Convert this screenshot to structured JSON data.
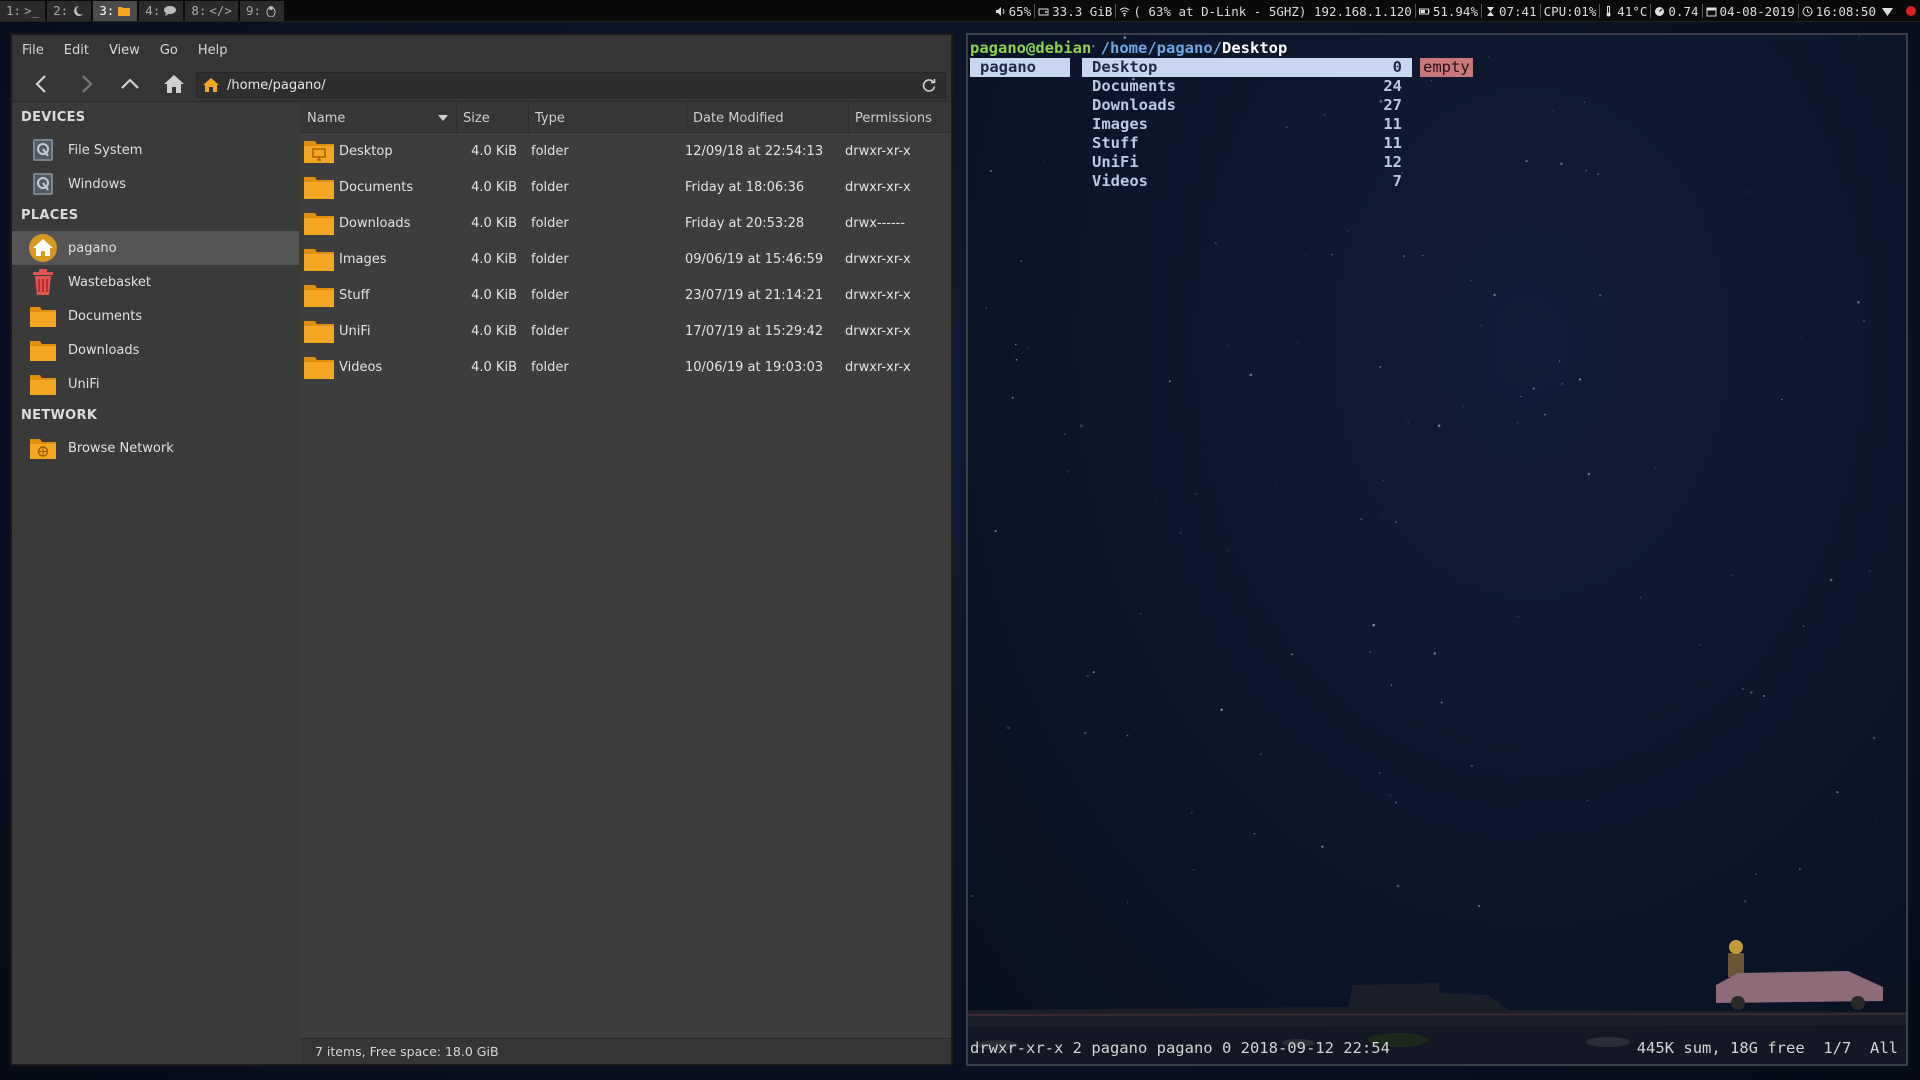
{
  "topbar": {
    "workspaces": [
      {
        "num": "1:",
        "icon": "terminal-icon",
        "glyph": ">_"
      },
      {
        "num": "2:",
        "icon": "moon-icon",
        "glyph": ""
      },
      {
        "num": "3:",
        "icon": "folder-icon",
        "glyph": "",
        "focused": true
      },
      {
        "num": "4:",
        "icon": "chat-icon",
        "glyph": ""
      },
      {
        "num": "8:",
        "icon": "code-icon",
        "glyph": "</>"
      },
      {
        "num": "9:",
        "icon": "linux-icon",
        "glyph": ""
      }
    ],
    "volume": "65%",
    "disk": "33.3 GiB",
    "wifi": "( 63% at D-Link - 5GHZ) 192.168.1.120",
    "battery": "51.94%",
    "battery_time": "07:41",
    "cpu": "CPU:01%",
    "temp": "41°C",
    "load": "0.74",
    "date": "04-08-2019",
    "time": "16:08:50"
  },
  "filemanager": {
    "menu": [
      "File",
      "Edit",
      "View",
      "Go",
      "Help"
    ],
    "location": "/home/pagano/",
    "sidebar": {
      "devices_heading": "DEVICES",
      "devices": [
        {
          "label": "File System",
          "icon": "drive-icon"
        },
        {
          "label": "Windows",
          "icon": "drive-icon"
        }
      ],
      "places_heading": "PLACES",
      "places": [
        {
          "label": "pagano",
          "icon": "home-icon",
          "selected": true
        },
        {
          "label": "Wastebasket",
          "icon": "trash-icon"
        },
        {
          "label": "Documents",
          "icon": "folder-icon"
        },
        {
          "label": "Downloads",
          "icon": "folder-icon"
        },
        {
          "label": "UniFi",
          "icon": "folder-icon"
        }
      ],
      "network_heading": "NETWORK",
      "network": [
        {
          "label": "Browse Network",
          "icon": "network-folder-icon"
        }
      ]
    },
    "columns": [
      "Name",
      "Size",
      "Type",
      "Date Modified",
      "Permissions"
    ],
    "rows": [
      {
        "name": "Desktop",
        "size": "4.0 KiB",
        "type": "folder",
        "date": "12/09/18 at 22:54:13",
        "perm": "drwxr-xr-x",
        "icon": "desktop-folder-icon"
      },
      {
        "name": "Documents",
        "size": "4.0 KiB",
        "type": "folder",
        "date": "Friday at 18:06:36",
        "perm": "drwxr-xr-x",
        "icon": "folder-icon"
      },
      {
        "name": "Downloads",
        "size": "4.0 KiB",
        "type": "folder",
        "date": "Friday at 20:53:28",
        "perm": "drwx------",
        "icon": "folder-icon"
      },
      {
        "name": "Images",
        "size": "4.0 KiB",
        "type": "folder",
        "date": "09/06/19 at 15:46:59",
        "perm": "drwxr-xr-x",
        "icon": "folder-icon"
      },
      {
        "name": "Stuff",
        "size": "4.0 KiB",
        "type": "folder",
        "date": "23/07/19 at 21:14:21",
        "perm": "drwxr-xr-x",
        "icon": "folder-icon"
      },
      {
        "name": "UniFi",
        "size": "4.0 KiB",
        "type": "folder",
        "date": "17/07/19 at 15:29:42",
        "perm": "drwxr-xr-x",
        "icon": "folder-icon"
      },
      {
        "name": "Videos",
        "size": "4.0 KiB",
        "type": "folder",
        "date": "10/06/19 at 19:03:03",
        "perm": "drwxr-xr-x",
        "icon": "folder-icon"
      }
    ],
    "status": "7 items, Free space: 18.0 GiB"
  },
  "terminal": {
    "prompt_user": "pagano@debian",
    "prompt_path": "/home/pagano/",
    "prompt_current": "Desktop",
    "parent": "pagano",
    "entries": [
      {
        "name": "Desktop",
        "count": "0",
        "selected": true
      },
      {
        "name": "Documents",
        "count": "24"
      },
      {
        "name": "Downloads",
        "count": "27"
      },
      {
        "name": "Images",
        "count": "11"
      },
      {
        "name": "Stuff",
        "count": "11"
      },
      {
        "name": "UniFi",
        "count": "12"
      },
      {
        "name": "Videos",
        "count": "7"
      }
    ],
    "preview": "empty",
    "status_left": "drwxr-xr-x 2 pagano pagano 0 2018-09-12 22:54",
    "status_right": "445K sum, 18G free  1/7  All"
  },
  "colors": {
    "folder": "#f5a623",
    "accent_green": "#8fd14f",
    "accent_blue": "#6fa6e6",
    "selection": "#c8d7f0",
    "empty_tag": "#c9787a"
  }
}
